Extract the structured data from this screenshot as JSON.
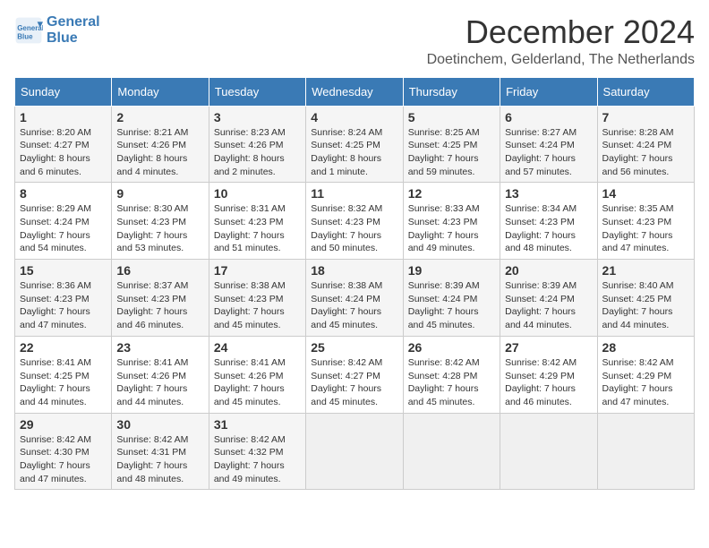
{
  "logo": {
    "line1": "General",
    "line2": "Blue"
  },
  "title": "December 2024",
  "subtitle": "Doetinchem, Gelderland, The Netherlands",
  "weekdays": [
    "Sunday",
    "Monday",
    "Tuesday",
    "Wednesday",
    "Thursday",
    "Friday",
    "Saturday"
  ],
  "weeks": [
    [
      {
        "day": "1",
        "info": "Sunrise: 8:20 AM\nSunset: 4:27 PM\nDaylight: 8 hours\nand 6 minutes."
      },
      {
        "day": "2",
        "info": "Sunrise: 8:21 AM\nSunset: 4:26 PM\nDaylight: 8 hours\nand 4 minutes."
      },
      {
        "day": "3",
        "info": "Sunrise: 8:23 AM\nSunset: 4:26 PM\nDaylight: 8 hours\nand 2 minutes."
      },
      {
        "day": "4",
        "info": "Sunrise: 8:24 AM\nSunset: 4:25 PM\nDaylight: 8 hours\nand 1 minute."
      },
      {
        "day": "5",
        "info": "Sunrise: 8:25 AM\nSunset: 4:25 PM\nDaylight: 7 hours\nand 59 minutes."
      },
      {
        "day": "6",
        "info": "Sunrise: 8:27 AM\nSunset: 4:24 PM\nDaylight: 7 hours\nand 57 minutes."
      },
      {
        "day": "7",
        "info": "Sunrise: 8:28 AM\nSunset: 4:24 PM\nDaylight: 7 hours\nand 56 minutes."
      }
    ],
    [
      {
        "day": "8",
        "info": "Sunrise: 8:29 AM\nSunset: 4:24 PM\nDaylight: 7 hours\nand 54 minutes."
      },
      {
        "day": "9",
        "info": "Sunrise: 8:30 AM\nSunset: 4:23 PM\nDaylight: 7 hours\nand 53 minutes."
      },
      {
        "day": "10",
        "info": "Sunrise: 8:31 AM\nSunset: 4:23 PM\nDaylight: 7 hours\nand 51 minutes."
      },
      {
        "day": "11",
        "info": "Sunrise: 8:32 AM\nSunset: 4:23 PM\nDaylight: 7 hours\nand 50 minutes."
      },
      {
        "day": "12",
        "info": "Sunrise: 8:33 AM\nSunset: 4:23 PM\nDaylight: 7 hours\nand 49 minutes."
      },
      {
        "day": "13",
        "info": "Sunrise: 8:34 AM\nSunset: 4:23 PM\nDaylight: 7 hours\nand 48 minutes."
      },
      {
        "day": "14",
        "info": "Sunrise: 8:35 AM\nSunset: 4:23 PM\nDaylight: 7 hours\nand 47 minutes."
      }
    ],
    [
      {
        "day": "15",
        "info": "Sunrise: 8:36 AM\nSunset: 4:23 PM\nDaylight: 7 hours\nand 47 minutes."
      },
      {
        "day": "16",
        "info": "Sunrise: 8:37 AM\nSunset: 4:23 PM\nDaylight: 7 hours\nand 46 minutes."
      },
      {
        "day": "17",
        "info": "Sunrise: 8:38 AM\nSunset: 4:23 PM\nDaylight: 7 hours\nand 45 minutes."
      },
      {
        "day": "18",
        "info": "Sunrise: 8:38 AM\nSunset: 4:24 PM\nDaylight: 7 hours\nand 45 minutes."
      },
      {
        "day": "19",
        "info": "Sunrise: 8:39 AM\nSunset: 4:24 PM\nDaylight: 7 hours\nand 45 minutes."
      },
      {
        "day": "20",
        "info": "Sunrise: 8:39 AM\nSunset: 4:24 PM\nDaylight: 7 hours\nand 44 minutes."
      },
      {
        "day": "21",
        "info": "Sunrise: 8:40 AM\nSunset: 4:25 PM\nDaylight: 7 hours\nand 44 minutes."
      }
    ],
    [
      {
        "day": "22",
        "info": "Sunrise: 8:41 AM\nSunset: 4:25 PM\nDaylight: 7 hours\nand 44 minutes."
      },
      {
        "day": "23",
        "info": "Sunrise: 8:41 AM\nSunset: 4:26 PM\nDaylight: 7 hours\nand 44 minutes."
      },
      {
        "day": "24",
        "info": "Sunrise: 8:41 AM\nSunset: 4:26 PM\nDaylight: 7 hours\nand 45 minutes."
      },
      {
        "day": "25",
        "info": "Sunrise: 8:42 AM\nSunset: 4:27 PM\nDaylight: 7 hours\nand 45 minutes."
      },
      {
        "day": "26",
        "info": "Sunrise: 8:42 AM\nSunset: 4:28 PM\nDaylight: 7 hours\nand 45 minutes."
      },
      {
        "day": "27",
        "info": "Sunrise: 8:42 AM\nSunset: 4:29 PM\nDaylight: 7 hours\nand 46 minutes."
      },
      {
        "day": "28",
        "info": "Sunrise: 8:42 AM\nSunset: 4:29 PM\nDaylight: 7 hours\nand 47 minutes."
      }
    ],
    [
      {
        "day": "29",
        "info": "Sunrise: 8:42 AM\nSunset: 4:30 PM\nDaylight: 7 hours\nand 47 minutes."
      },
      {
        "day": "30",
        "info": "Sunrise: 8:42 AM\nSunset: 4:31 PM\nDaylight: 7 hours\nand 48 minutes."
      },
      {
        "day": "31",
        "info": "Sunrise: 8:42 AM\nSunset: 4:32 PM\nDaylight: 7 hours\nand 49 minutes."
      },
      null,
      null,
      null,
      null
    ]
  ]
}
